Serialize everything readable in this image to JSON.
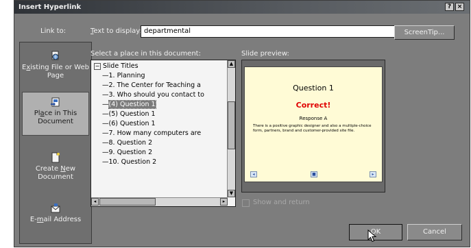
{
  "window": {
    "title": "Insert Hyperlink",
    "help_glyph": "?",
    "close_glyph": "×"
  },
  "link_to": {
    "label": "Link to:",
    "items": [
      {
        "label_pre": "E",
        "label_u": "x",
        "label_post": "isting File or Web Page",
        "icon": "existing-file-icon"
      },
      {
        "label_pre": "Pl",
        "label_u": "a",
        "label_post": "ce in This Document",
        "icon": "place-in-document-icon"
      },
      {
        "label_pre": "Create ",
        "label_u": "N",
        "label_post": "ew Document",
        "icon": "new-document-icon"
      },
      {
        "label_pre": "E-",
        "label_u": "m",
        "label_post": "ail Address",
        "icon": "email-icon"
      }
    ],
    "selected_index": 1
  },
  "text_to_display": {
    "label_u": "T",
    "label_post": "ext to display:",
    "value": "departmental"
  },
  "screentip_button": "ScreenTip...",
  "place_section": {
    "label": "Select a place in this document:",
    "root": "Slide Titles",
    "items": [
      "1. Planning",
      "2. The Center for Teaching a",
      "3. Who should you contact to",
      "(4) Question 1",
      "(5) Question 1",
      "(6) Question 1",
      "7. How many computers are",
      "8. Question 2",
      "9. Question 2",
      "10. Question 2"
    ],
    "selected_index": 3
  },
  "preview": {
    "label": "Slide preview:",
    "slide_title": "Question 1",
    "slide_heading": "Correct!",
    "slide_subheading": "Response A",
    "slide_body": "There is a positive graphic designer and also a multiple-choice form, partners, brand and customer-provided site file.",
    "nav_prev": "◂",
    "nav_home": "■",
    "nav_next": "▸"
  },
  "show_and_return": {
    "label": "Show and return",
    "checked": false
  },
  "buttons": {
    "ok": "OK",
    "cancel": "Cancel"
  }
}
